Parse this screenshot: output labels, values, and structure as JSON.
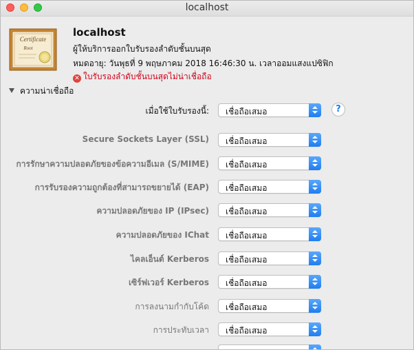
{
  "window": {
    "title": "localhost"
  },
  "header": {
    "name": "localhost",
    "issuer": "ผู้ให้บริการออกใบรับรองลำดับชั้นบนสุด",
    "expires": "หมดอายุ: วันพุธที่ 9 พฤษภาคม 2018 16:46:30 น. เวลาออมแสงแปซิฟิก",
    "error": "ใบรับรองลำดับชั้นบนสุดไม่น่าเชื่อถือ",
    "icon_text": {
      "title": "Certificate",
      "sub": "Root"
    }
  },
  "trust": {
    "section_label": "ความน่าเชื่อถือ",
    "primary": {
      "label": "เมื่อใช้ใบรับรองนี้:",
      "value": "เชื่อถือเสมอ"
    },
    "rows": [
      {
        "label": "Secure Sockets Layer (SSL)",
        "value": "เชื่อถือเสมอ"
      },
      {
        "label": "การรักษาความปลอดภัยของข้อความอีเมล (S/MIME)",
        "value": "เชื่อถือเสมอ"
      },
      {
        "label": "การรับรองความถูกต้องที่สามารถขยายได้ (EAP)",
        "value": "เชื่อถือเสมอ"
      },
      {
        "label": "ความปลอดภัยของ IP (IPsec)",
        "value": "เชื่อถือเสมอ"
      },
      {
        "label": "ความปลอดภัยของ IChat",
        "value": "เชื่อถือเสมอ"
      },
      {
        "label": "ไคลเอ็นต์ Kerberos",
        "value": "เชื่อถือเสมอ"
      },
      {
        "label": "เซิร์ฟเวอร์ Kerberos",
        "value": "เชื่อถือเสมอ"
      },
      {
        "label": "การลงนามกำกับโค้ด",
        "value": "เชื่อถือเสมอ"
      },
      {
        "label": "การประทับเวลา",
        "value": "เชื่อถือเสมอ"
      }
    ]
  },
  "colors": {
    "accent": "#1e7ef0",
    "error": "#d0021b"
  }
}
